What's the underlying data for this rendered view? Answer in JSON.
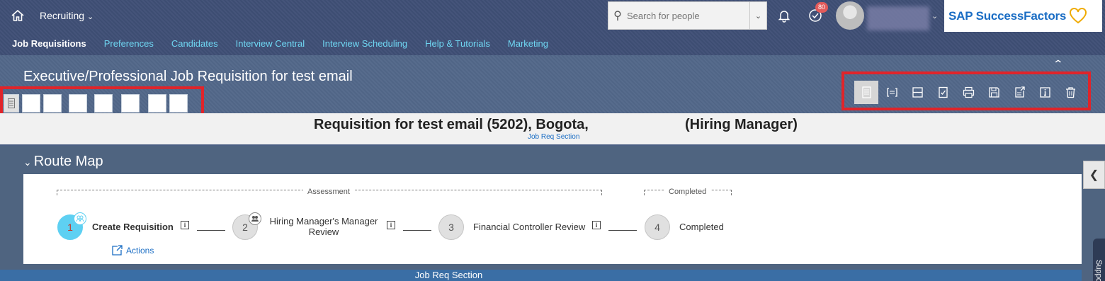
{
  "shell": {
    "module_label": "Recruiting",
    "search_placeholder": "Search for people",
    "notification_count": "80",
    "brand": "SAP SuccessFactors"
  },
  "nav": {
    "items": [
      {
        "label": "Job Requisitions",
        "active": true
      },
      {
        "label": "Preferences"
      },
      {
        "label": "Candidates"
      },
      {
        "label": "Interview Central"
      },
      {
        "label": "Interview Scheduling"
      },
      {
        "label": "Help & Tutorials"
      },
      {
        "label": "Marketing"
      }
    ]
  },
  "requisition": {
    "title": "Executive/Professional Job Requisition for test email",
    "summary": "Requisition for test email (5202), Bogota,",
    "summary_role": "(Hiring Manager)",
    "summary_link": "Job Req Section"
  },
  "toolbar": {
    "icons": [
      "page-icon",
      "expand-brackets-icon",
      "collapse-section-icon",
      "checklist-icon",
      "print-icon",
      "save-icon",
      "export-icon",
      "info-icon",
      "trash-icon"
    ]
  },
  "route_map": {
    "heading": "Route Map",
    "groups": [
      {
        "label": "Assessment"
      },
      {
        "label": "Completed"
      }
    ],
    "steps": [
      {
        "number": "1",
        "label": "Create Requisition",
        "current": true
      },
      {
        "number": "2",
        "label": "Hiring Manager's Manager Review"
      },
      {
        "number": "3",
        "label": "Financial Controller Review"
      },
      {
        "number": "4",
        "label": "Completed"
      }
    ],
    "actions_label": "Actions"
  },
  "footer": {
    "section_label": "Job Req Section",
    "support_label": "Support"
  },
  "colors": {
    "accent": "#1a6dc4",
    "highlight_box": "#e0242a",
    "current_step": "#5ed0f2"
  }
}
